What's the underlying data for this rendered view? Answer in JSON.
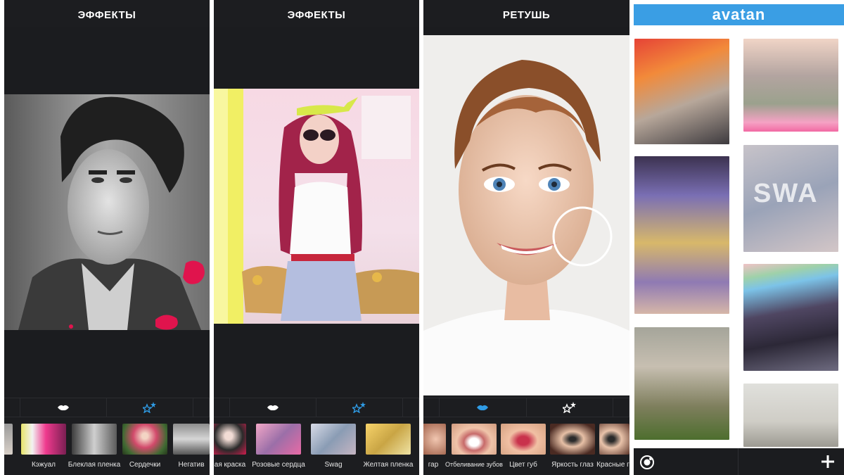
{
  "panels": [
    {
      "title": "ЭФФЕКТЫ",
      "tabs": [
        {
          "icon": "lips-icon",
          "selected": false
        },
        {
          "icon": "magic-stars-icon",
          "selected": true
        }
      ],
      "thumbnails": [
        "",
        "Кэжуал",
        "Блеклая пленка",
        "Сердечки",
        "Негатив"
      ]
    },
    {
      "title": "ЭФФЕКТЫ",
      "tabs": [
        {
          "icon": "lips-icon",
          "selected": false
        },
        {
          "icon": "magic-stars-icon",
          "selected": true
        }
      ],
      "thumbnails": [
        "ая краска",
        "Розовые сердца",
        "Swag",
        "Желтая пленка"
      ]
    },
    {
      "title": "РЕТУШЬ",
      "tabs": [
        {
          "icon": "lips-icon",
          "selected": true
        },
        {
          "icon": "magic-stars-icon",
          "selected": false
        }
      ],
      "thumbnails": [
        "гар",
        "Отбеливание зубов",
        "Цвет губ",
        "Яркость глаз",
        "Красные г"
      ]
    },
    {
      "logo": "avatan",
      "feed_tiles": [
        {
          "label": ""
        },
        {
          "label": ""
        },
        {
          "label": ""
        },
        {
          "label": "SWA"
        },
        {
          "label": ""
        },
        {
          "label": ""
        },
        {
          "label": ""
        },
        {
          "label": ""
        }
      ],
      "bottom_bar": {
        "left_icon": "camera-icon",
        "right_icon": "plus-icon"
      }
    }
  ],
  "colors": {
    "dark_bg": "#1c1d20",
    "accent_blue": "#2f9be4",
    "avatan_blue": "#3a9ee4",
    "icon_white": "#ffffff"
  }
}
